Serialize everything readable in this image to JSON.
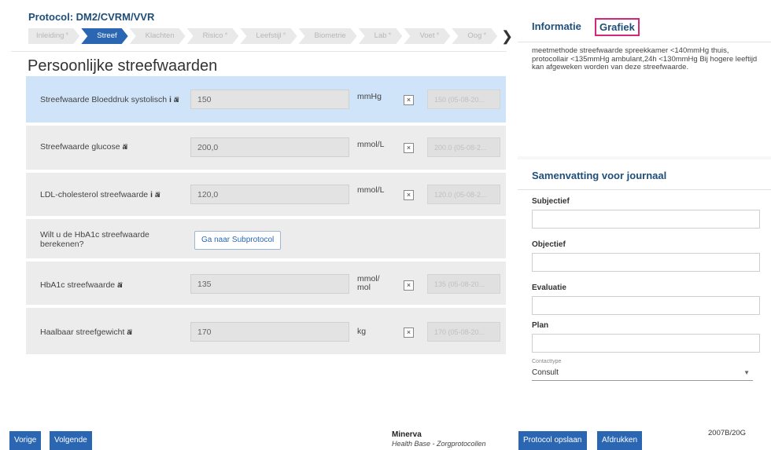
{
  "protocol": {
    "title": "Protocol: DM2/CVRM/VVR",
    "steps": [
      {
        "label": "Inleiding",
        "star": "*"
      },
      {
        "label": "Streef",
        "star": "",
        "active": true
      },
      {
        "label": "Klachten",
        "star": ""
      },
      {
        "label": "Risico",
        "star": "*"
      },
      {
        "label": "Leefstijl",
        "star": "*"
      },
      {
        "label": "Biometrie",
        "star": ""
      },
      {
        "label": "Lab",
        "star": "*"
      },
      {
        "label": "Voet",
        "star": "*"
      },
      {
        "label": "Oog",
        "star": "*"
      }
    ],
    "next_icon": "chevron-right-icon",
    "next_glyph": "❯"
  },
  "form": {
    "title": "Persoonlijke streefwaarden",
    "rows": [
      {
        "label": "Streefwaarde Bloeddruk systolisch",
        "info": "i",
        "family": "ăî",
        "value": "150",
        "unit": "mmHg",
        "check": "×",
        "previous": "150 (05-08-20..."
      },
      {
        "label": "Streefwaarde glucose",
        "family": "ăî",
        "value": "200,0",
        "unit": "mmol/L",
        "check": "×",
        "previous": "200.0 (05-08-2..."
      },
      {
        "label": "LDL-cholesterol streefwaarde",
        "info": "i",
        "family": "ăî",
        "value": "120,0",
        "unit": "mmol/L",
        "check": "×",
        "previous": "120.0 (05-08-2..."
      },
      {
        "label": "Wilt u de HbA1c streefwaarde berekenen?",
        "button": "Ga naar Subprotocol"
      },
      {
        "label": "HbA1c streefwaarde",
        "family": "ăî",
        "value": "135",
        "unit": "mmol/mol",
        "check": "×",
        "previous": "135 (05-08-20..."
      },
      {
        "label": "Haalbaar streefgewicht",
        "family": "ăî",
        "value": "170",
        "unit": "kg",
        "check": "×",
        "previous": "170 (05-08-20..."
      }
    ]
  },
  "right": {
    "tabs": [
      "Informatie",
      "Grafiek"
    ],
    "info_text": "meetmethode streefwaarde spreekkamer <140mmHg thuis, protocollair <135mmHg ambulant,24h <130mmHg Bij hogere leeftijd kan afgeweken worden van deze streefwaarde.",
    "summary_title": "Samenvatting voor journaal",
    "fields": [
      "Subjectief",
      "Objectief",
      "Evaluatie",
      "Plan"
    ],
    "contact_label": "Contacttype",
    "contact_value": "Consult",
    "contact_caret": "▼"
  },
  "footer": {
    "prev": "Vorige",
    "next": "Volgende",
    "brand": "Minerva",
    "brand_sub": "Health Base - Zorgprotocollen",
    "save": "Protocol opslaan",
    "print": "Afdrukken",
    "version": "2007B/20G"
  },
  "colors": {
    "accent": "#2b66b3",
    "title": "#1f4e79",
    "highlight": "#cfe3f9",
    "tab_border": "#d4267b"
  }
}
